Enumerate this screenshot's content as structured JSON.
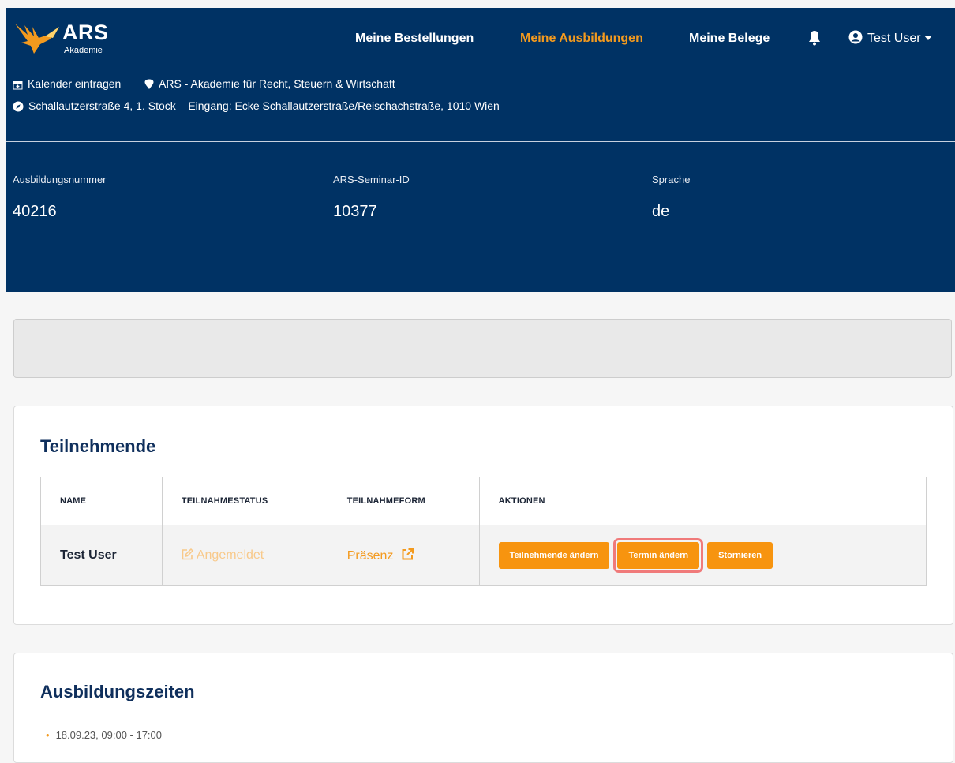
{
  "header": {
    "logo_text": "ARS",
    "logo_sub": "Akademie",
    "nav": [
      {
        "label": "Meine Bestellungen",
        "active": false
      },
      {
        "label": "Meine Ausbildungen",
        "active": true
      },
      {
        "label": "Meine Belege",
        "active": false
      }
    ],
    "bell_icon": "bell-icon",
    "user": {
      "name": "Test User",
      "icon": "user-circle-icon"
    }
  },
  "event": {
    "calendar_label": "Kalender eintragen",
    "calendar_icon": "calendar-plus-icon",
    "venue_name": "ARS - Akademie für Recht, Steuern & Wirtschaft",
    "venue_icon": "map-marker-icon",
    "address": "Schallautzerstraße 4, 1. Stock – Eingang: Ecke Schallautzerstraße/Reischachstraße, 1010 Wien",
    "address_icon": "compass-icon"
  },
  "meta": [
    {
      "label": "Ausbildungsnummer",
      "value": "40216"
    },
    {
      "label": "ARS-Seminar-ID",
      "value": "10377"
    },
    {
      "label": "Sprache",
      "value": "de"
    }
  ],
  "participants": {
    "title": "Teilnehmende",
    "columns": [
      "NAME",
      "TEILNAHMESTATUS",
      "TEILNAHMEFORM",
      "AKTIONEN"
    ],
    "rows": [
      {
        "name": "Test User",
        "status": "Angemeldet",
        "status_icon": "edit-icon",
        "form": "Präsenz",
        "form_icon": "external-link-icon",
        "actions": [
          "Teilnehmende ändern",
          "Termin ändern",
          "Stornieren"
        ]
      }
    ]
  },
  "schedule": {
    "title": "Ausbildungszeiten",
    "items": [
      "18.09.23, 09:00 - 17:00"
    ]
  },
  "colors": {
    "header_bg": "#003264",
    "accent": "#f7940f",
    "highlight": "#f07a7a"
  }
}
